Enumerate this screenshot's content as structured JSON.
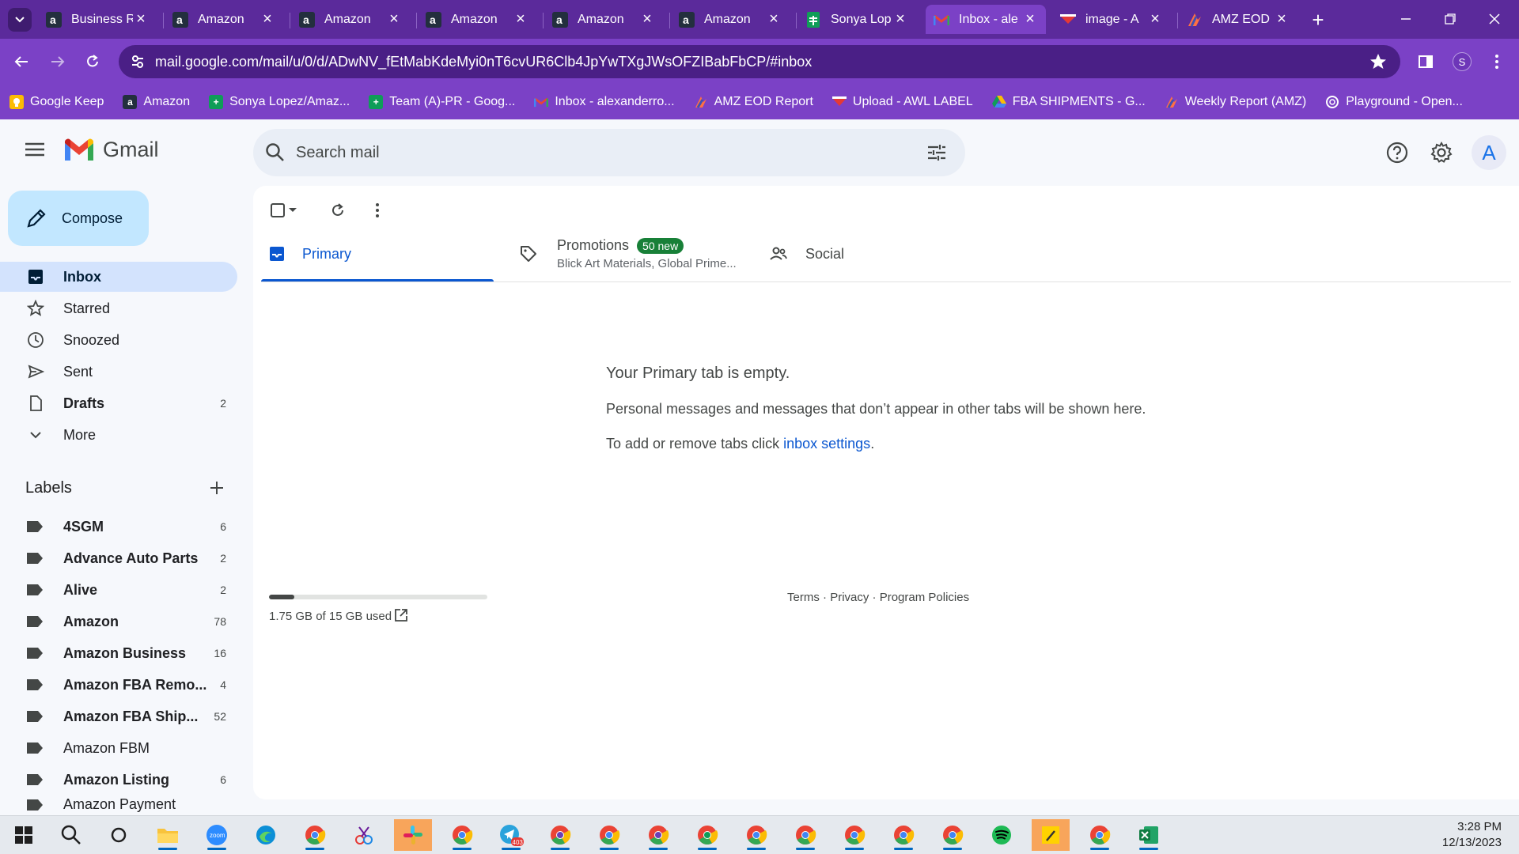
{
  "browser": {
    "tabs": [
      {
        "title": "Business R",
        "icon": "amazon-icon"
      },
      {
        "title": "Amazon",
        "icon": "amazon-icon"
      },
      {
        "title": "Amazon",
        "icon": "amazon-icon"
      },
      {
        "title": "Amazon",
        "icon": "amazon-icon"
      },
      {
        "title": "Amazon",
        "icon": "amazon-icon"
      },
      {
        "title": "Amazon",
        "icon": "amazon-icon"
      },
      {
        "title": "Sonya Lop",
        "icon": "sheets-icon"
      },
      {
        "title": "Inbox - ale",
        "icon": "gmail-icon"
      },
      {
        "title": "image - A",
        "icon": "awl-icon"
      },
      {
        "title": "AMZ EOD",
        "icon": "eod-icon"
      }
    ],
    "url": "mail.google.com/mail/u/0/d/ADwNV_fEtMabKdeMyi0nT6cvUR6Clb4JpYwTXgJWsOFZIBabFbCP/#inbox",
    "profile_initial": "S",
    "bookmarks": [
      {
        "label": "Google Keep",
        "icon": "keep-icon",
        "color": "#fbbc04"
      },
      {
        "label": "Amazon",
        "icon": "amazon-icon",
        "color": "#232f3e"
      },
      {
        "label": "Sonya Lopez/Amaz...",
        "icon": "sheets-icon",
        "color": "#0f9d58"
      },
      {
        "label": "Team (A)-PR - Goog...",
        "icon": "sheets-icon",
        "color": "#0f9d58"
      },
      {
        "label": "Inbox - alexanderro...",
        "icon": "gmail-icon",
        "color": "#ea4335"
      },
      {
        "label": "AMZ EOD Report",
        "icon": "eod-icon",
        "color": "#ff7043"
      },
      {
        "label": "Upload - AWL LABEL",
        "icon": "awl-icon",
        "color": "#c62828"
      },
      {
        "label": "FBA SHIPMENTS - G...",
        "icon": "drive-icon",
        "color": "#fbbc04"
      },
      {
        "label": "Weekly Report (AMZ)",
        "icon": "eod-icon",
        "color": "#ff7043"
      },
      {
        "label": "Playground - Open...",
        "icon": "openai-icon",
        "color": "#202124"
      }
    ]
  },
  "gmail": {
    "logo_text": "Gmail",
    "search_placeholder": "Search mail",
    "avatar_initial": "A",
    "compose_label": "Compose",
    "nav": [
      {
        "label": "Inbox",
        "icon": "inbox-icon",
        "count": "",
        "active": true,
        "bold": true
      },
      {
        "label": "Starred",
        "icon": "star-icon",
        "count": "",
        "active": false,
        "bold": false
      },
      {
        "label": "Snoozed",
        "icon": "clock-icon",
        "count": "",
        "active": false,
        "bold": false
      },
      {
        "label": "Sent",
        "icon": "send-icon",
        "count": "",
        "active": false,
        "bold": false
      },
      {
        "label": "Drafts",
        "icon": "draft-icon",
        "count": "2",
        "active": false,
        "bold": true
      },
      {
        "label": "More",
        "icon": "chevron-down-icon",
        "count": "",
        "active": false,
        "bold": false
      }
    ],
    "labels_header": "Labels",
    "labels": [
      {
        "name": "4SGM",
        "count": "6",
        "bold": true
      },
      {
        "name": "Advance Auto Parts",
        "count": "2",
        "bold": true
      },
      {
        "name": "Alive",
        "count": "2",
        "bold": true
      },
      {
        "name": "Amazon",
        "count": "78",
        "bold": true
      },
      {
        "name": "Amazon Business",
        "count": "16",
        "bold": true
      },
      {
        "name": "Amazon FBA Remo...",
        "count": "4",
        "bold": true
      },
      {
        "name": "Amazon FBA Ship...",
        "count": "52",
        "bold": true
      },
      {
        "name": "Amazon FBM",
        "count": "",
        "bold": false
      },
      {
        "name": "Amazon Listing",
        "count": "6",
        "bold": true
      },
      {
        "name": "Amazon Payment",
        "count": "",
        "bold": false
      }
    ],
    "categories": [
      {
        "name": "Primary",
        "sub": "",
        "badge": "",
        "icon": "inbox-icon",
        "active": true
      },
      {
        "name": "Promotions",
        "sub": "Blick Art Materials, Global Prime...",
        "badge": "50 new",
        "icon": "tag-icon",
        "active": false
      },
      {
        "name": "Social",
        "sub": "",
        "badge": "",
        "icon": "people-icon",
        "active": false
      }
    ],
    "empty_title": "Your Primary tab is empty.",
    "empty_line": "Personal messages and messages that don’t appear in other tabs will be shown here.",
    "empty_prefix": "To add or remove tabs click ",
    "empty_link": "inbox settings",
    "empty_suffix": ".",
    "storage_text": "1.75 GB of 15 GB used",
    "storage_fraction": 0.117,
    "footer_terms": "Terms",
    "footer_privacy": "Privacy",
    "footer_policies": "Program Policies",
    "footer_sep": " · "
  },
  "taskbar": {
    "time": "3:28 PM",
    "date": "12/13/2023",
    "telegram_badge": "403",
    "apps": [
      "windows-start-icon",
      "search-icon",
      "cortana-icon",
      "file-explorer-icon",
      "zoom-icon",
      "edge-icon",
      "chrome-icon",
      "snipping-icon",
      "slack-icon",
      "chrome-icon",
      "telegram-icon",
      "chrome-icon",
      "chrome-icon",
      "chrome-icon",
      "chrome-icon",
      "chrome-icon",
      "chrome-icon",
      "chrome-icon",
      "chrome-icon",
      "chrome-icon",
      "spotify-icon",
      "sticky-notes-icon",
      "chrome-icon",
      "excel-icon"
    ]
  },
  "colors": {
    "chrome_frame": "#5b2a9b",
    "chrome_toolbar": "#7b41c6",
    "gmail_accent": "#0b57d0",
    "compose_bg": "#c2e7ff",
    "inbox_active_bg": "#d3e3fd",
    "badge_green": "#188038"
  }
}
